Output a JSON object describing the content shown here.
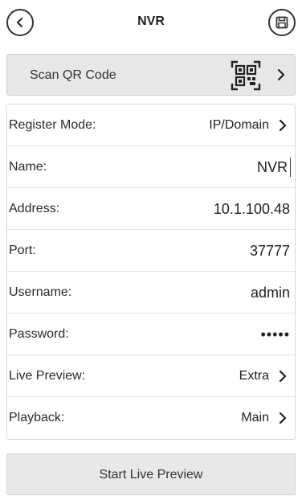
{
  "header": {
    "title": "NVR",
    "back_icon": "back-arrow-icon",
    "save_icon": "save-icon"
  },
  "scan": {
    "label": "Scan QR Code",
    "icon": "qr-code-icon"
  },
  "form": {
    "rows": [
      {
        "label": "Register Mode:",
        "value": "IP/Domain"
      },
      {
        "label": "Name:",
        "value": "NVR"
      },
      {
        "label": "Address:",
        "value": "10.1.100.48"
      },
      {
        "label": "Port:",
        "value": "37777"
      },
      {
        "label": "Username:",
        "value": "admin"
      },
      {
        "label": "Password:",
        "value": "•••••"
      },
      {
        "label": "Live Preview:",
        "value": "Extra"
      },
      {
        "label": "Playback:",
        "value": "Main"
      }
    ]
  },
  "actions": {
    "start_live_preview": "Start Live Preview"
  }
}
